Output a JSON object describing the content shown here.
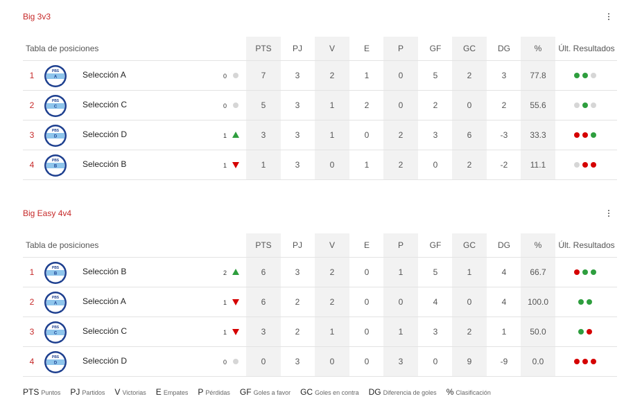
{
  "columns": {
    "table_label": "Tabla de posiciones",
    "pts": "PTS",
    "pj": "PJ",
    "v": "V",
    "e": "E",
    "p": "P",
    "gf": "GF",
    "gc": "GC",
    "dg": "DG",
    "pct": "%",
    "ult": "Últ. Resultados"
  },
  "groups": [
    {
      "title": "Big 3v3",
      "rows": [
        {
          "rank": "1",
          "team": "Selección A",
          "logo_letter": "A",
          "trend": "0",
          "trend_dir": "neutral",
          "pts": "7",
          "pj": "3",
          "v": "2",
          "e": "1",
          "p": "0",
          "gf": "5",
          "gc": "2",
          "dg": "3",
          "pct": "77.8",
          "results": [
            "w",
            "w",
            "d"
          ]
        },
        {
          "rank": "2",
          "team": "Selección C",
          "logo_letter": "C",
          "trend": "0",
          "trend_dir": "neutral",
          "pts": "5",
          "pj": "3",
          "v": "1",
          "e": "2",
          "p": "0",
          "gf": "2",
          "gc": "0",
          "dg": "2",
          "pct": "55.6",
          "results": [
            "d",
            "w",
            "d"
          ]
        },
        {
          "rank": "3",
          "team": "Selección D",
          "logo_letter": "D",
          "trend": "1",
          "trend_dir": "up",
          "pts": "3",
          "pj": "3",
          "v": "1",
          "e": "0",
          "p": "2",
          "gf": "3",
          "gc": "6",
          "dg": "-3",
          "pct": "33.3",
          "results": [
            "l",
            "l",
            "w"
          ]
        },
        {
          "rank": "4",
          "team": "Selección B",
          "logo_letter": "B",
          "trend": "1",
          "trend_dir": "down",
          "pts": "1",
          "pj": "3",
          "v": "0",
          "e": "1",
          "p": "2",
          "gf": "0",
          "gc": "2",
          "dg": "-2",
          "pct": "11.1",
          "results": [
            "d",
            "l",
            "l"
          ]
        }
      ]
    },
    {
      "title": "Big Easy 4v4",
      "rows": [
        {
          "rank": "1",
          "team": "Selección B",
          "logo_letter": "B",
          "trend": "2",
          "trend_dir": "up",
          "pts": "6",
          "pj": "3",
          "v": "2",
          "e": "0",
          "p": "1",
          "gf": "5",
          "gc": "1",
          "dg": "4",
          "pct": "66.7",
          "results": [
            "l",
            "w",
            "w"
          ]
        },
        {
          "rank": "2",
          "team": "Selección A",
          "logo_letter": "A",
          "trend": "1",
          "trend_dir": "down",
          "pts": "6",
          "pj": "2",
          "v": "2",
          "e": "0",
          "p": "0",
          "gf": "4",
          "gc": "0",
          "dg": "4",
          "pct": "100.0",
          "results": [
            "w",
            "w"
          ]
        },
        {
          "rank": "3",
          "team": "Selección C",
          "logo_letter": "C",
          "trend": "1",
          "trend_dir": "down",
          "pts": "3",
          "pj": "2",
          "v": "1",
          "e": "0",
          "p": "1",
          "gf": "3",
          "gc": "2",
          "dg": "1",
          "pct": "50.0",
          "results": [
            "w",
            "l"
          ]
        },
        {
          "rank": "4",
          "team": "Selección D",
          "logo_letter": "D",
          "trend": "0",
          "trend_dir": "neutral",
          "pts": "0",
          "pj": "3",
          "v": "0",
          "e": "0",
          "p": "3",
          "gf": "0",
          "gc": "9",
          "dg": "-9",
          "pct": "0.0",
          "results": [
            "l",
            "l",
            "l"
          ]
        }
      ]
    }
  ],
  "logo_text": {
    "top": "PBS",
    "bottom": "SELECCIÓN"
  },
  "legend": [
    {
      "abbr": "PTS",
      "desc": "Puntos"
    },
    {
      "abbr": "PJ",
      "desc": "Partidos"
    },
    {
      "abbr": "V",
      "desc": "Victorias"
    },
    {
      "abbr": "E",
      "desc": "Empates"
    },
    {
      "abbr": "P",
      "desc": "Pérdidas"
    },
    {
      "abbr": "GF",
      "desc": "Goles a favor"
    },
    {
      "abbr": "GC",
      "desc": "Goles en contra"
    },
    {
      "abbr": "DG",
      "desc": "Diferencia de goles"
    },
    {
      "abbr": "%",
      "desc": "Clasificación"
    }
  ],
  "colors": {
    "accent": "#c62828",
    "win": "#2e9e3e",
    "loss": "#d50000",
    "draw": "#d6d6d6",
    "shade": "#f2f2f2"
  }
}
